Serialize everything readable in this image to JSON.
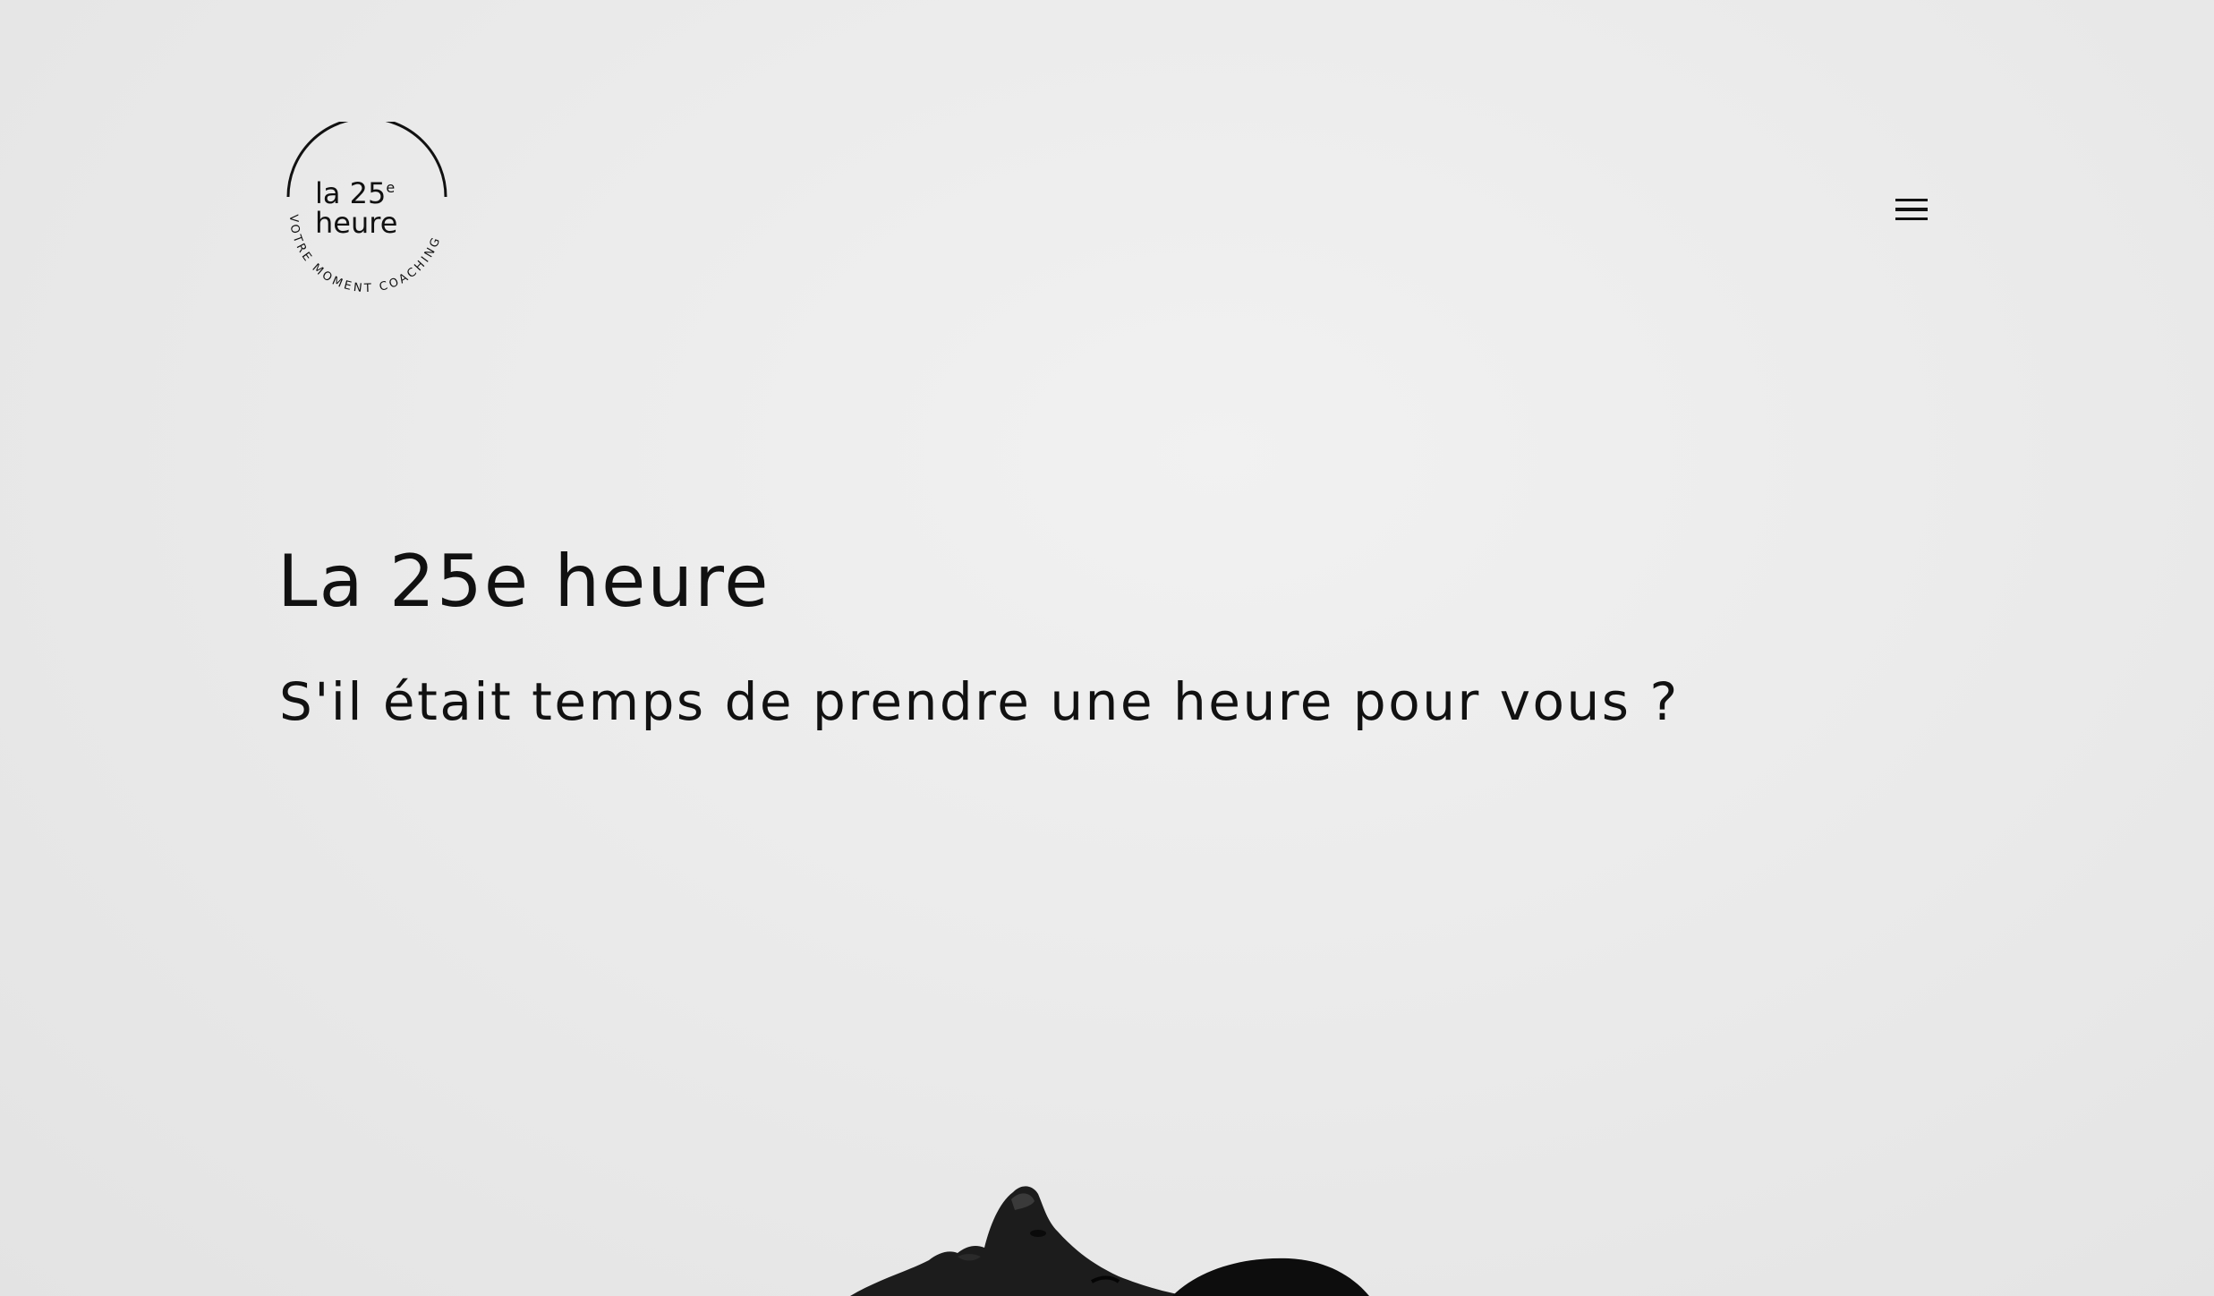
{
  "header": {
    "logo": {
      "line1": "la 25",
      "superscript": "e",
      "line2": "heure",
      "tagline": "VOTRE MOMENT COACHING"
    },
    "menu_icon": "hamburger-menu-icon"
  },
  "hero": {
    "title": "La 25e heure",
    "subtitle": "S'il était temps de prendre une heure pour vous ?"
  },
  "colors": {
    "text": "#111111",
    "background": "#ebebeb"
  }
}
